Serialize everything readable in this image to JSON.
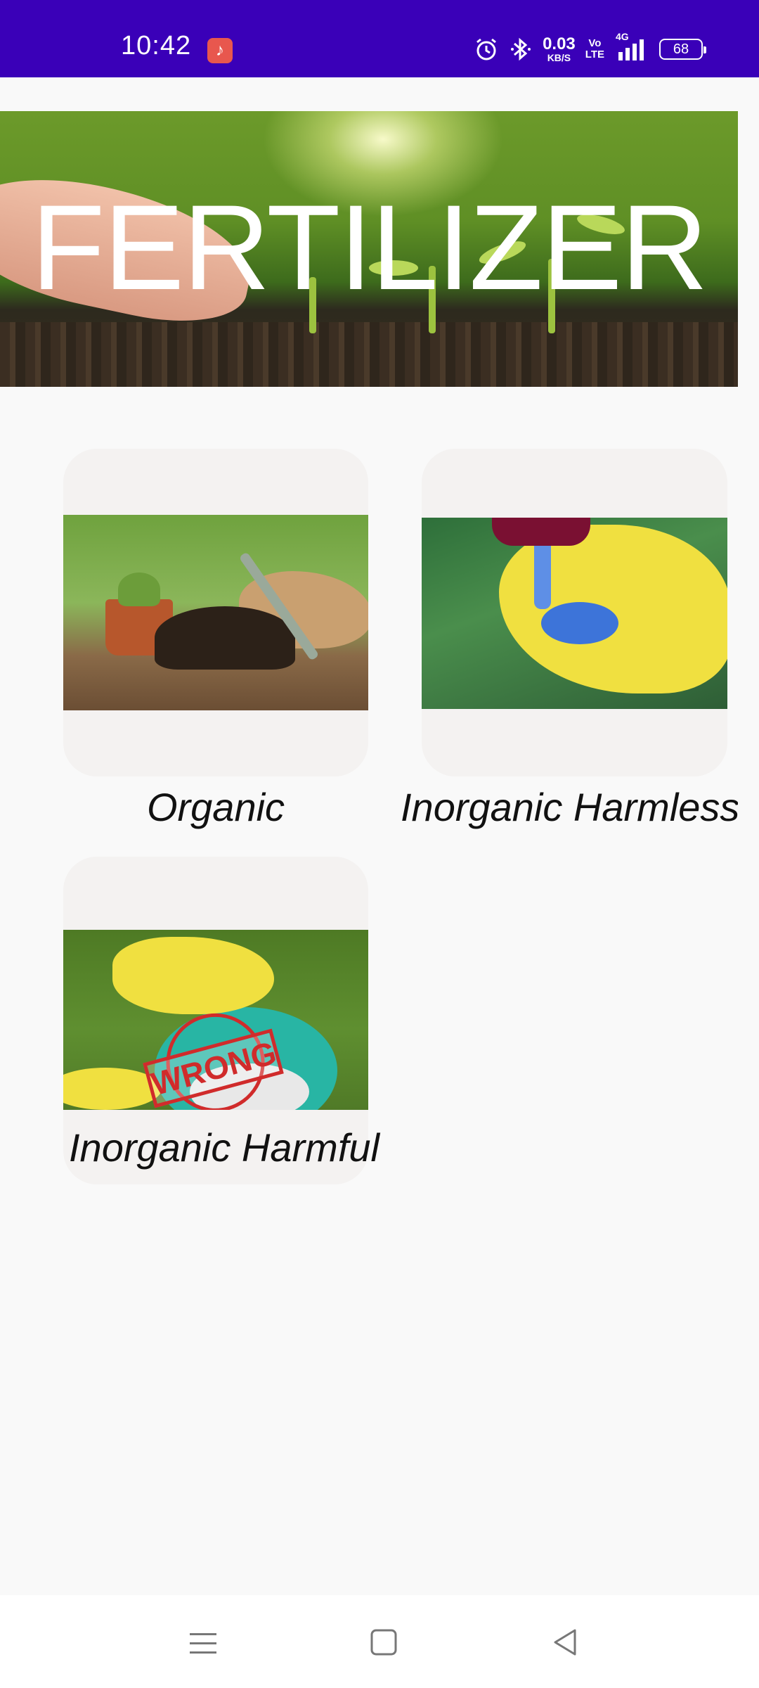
{
  "status_bar": {
    "time": "10:42",
    "network_speed_value": "0.03",
    "network_speed_unit": "KB/S",
    "volte_top": "Vo",
    "volte_bottom": "LTE",
    "network_type": "4G",
    "battery_level": "68",
    "background_color": "#3a00b8"
  },
  "banner": {
    "title": "FERTILIZER"
  },
  "categories": [
    {
      "label": "Organic",
      "image_icon": "organic-fertilizer-image"
    },
    {
      "label": "Inorganic Harmless",
      "image_icon": "inorganic-harmless-image"
    },
    {
      "label": "Inorganic Harmful",
      "image_icon": "inorganic-harmful-image",
      "stamp_text": "WRONG"
    }
  ],
  "navigation_bar": {
    "buttons": [
      "menu-icon",
      "home-icon",
      "back-icon"
    ]
  }
}
